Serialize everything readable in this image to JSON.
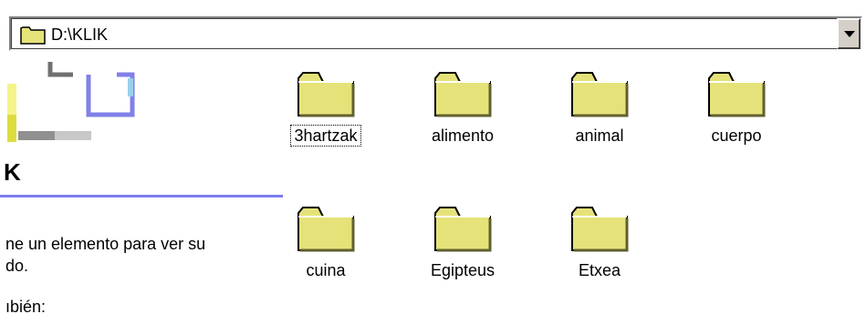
{
  "address_bar": {
    "path": "D:\\KLIK"
  },
  "left_pane": {
    "title": "K",
    "description": "ne un elemento para ver su do.",
    "description_line1": "ne un elemento para ver su",
    "description_line2": "do.",
    "see_also": "ıbién:",
    "accent_color": "#7b7bf0"
  },
  "folders": [
    {
      "name": "3hartzak",
      "focused": true
    },
    {
      "name": "alimento",
      "focused": false
    },
    {
      "name": "animal",
      "focused": false
    },
    {
      "name": "cuerpo",
      "focused": false
    },
    {
      "name": "cuina",
      "focused": false
    },
    {
      "name": "Egipteus",
      "focused": false
    },
    {
      "name": "Etxea",
      "focused": false
    }
  ],
  "colors": {
    "folder_fill": "#e6e27a",
    "folder_outline": "#000000",
    "window_face": "#d4d0c8"
  }
}
